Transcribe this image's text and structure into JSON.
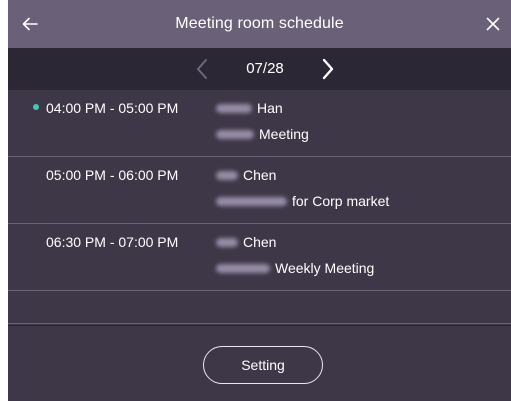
{
  "header": {
    "title": "Meeting room schedule",
    "back_icon": "arrow-left-icon",
    "close_icon": "close-icon",
    "background": "#6a6179"
  },
  "date_nav": {
    "date": "07/28",
    "prev_icon": "chevron-left-icon",
    "next_icon": "chevron-right-icon",
    "prev_enabled": false,
    "next_enabled": true
  },
  "meetings": [
    {
      "time": "04:00 PM - 05:00 PM",
      "organizer": "Han",
      "subject": "Meeting",
      "current": true
    },
    {
      "time": "05:00 PM - 06:00 PM",
      "organizer": "Chen",
      "subject": "for Corp market",
      "current": false
    },
    {
      "time": "06:30 PM - 07:00 PM",
      "organizer": "Chen",
      "subject": "Weekly Meeting",
      "current": false
    }
  ],
  "footer": {
    "setting_label": "Setting"
  },
  "colors": {
    "current_indicator": "#3fc8b4",
    "background": "#3e3747",
    "date_bar": "#2c2734"
  }
}
